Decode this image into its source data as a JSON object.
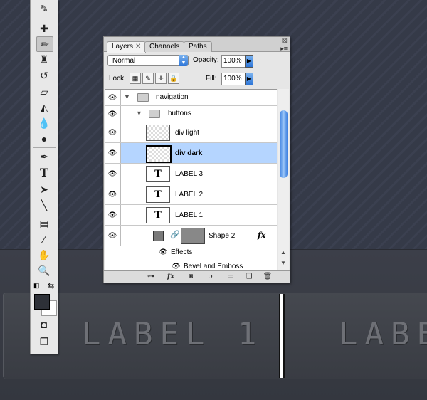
{
  "canvas": {
    "buttons": [
      "LABEL 1",
      "LABE"
    ]
  },
  "tools": {
    "items": [
      "pen-tool",
      "brush",
      "pencil",
      "stamp",
      "history-brush",
      "eraser",
      "paint-bucket",
      "blur",
      "dodge",
      "pen",
      "type",
      "direct-select",
      "line",
      "notes",
      "eyedropper",
      "hand",
      "zoom"
    ]
  },
  "panel": {
    "tabs": [
      "Layers",
      "Channels",
      "Paths"
    ],
    "close_glyph": "✕",
    "blend_mode": "Normal",
    "opacity_label": "Opacity:",
    "opacity_value": "100%",
    "lock_label": "Lock:",
    "fill_label": "Fill:",
    "fill_value": "100%",
    "layers": [
      {
        "name": "navigation"
      },
      {
        "name": "buttons"
      },
      {
        "name": "div light"
      },
      {
        "name": "div dark"
      },
      {
        "name": "LABEL 3"
      },
      {
        "name": "LABEL 2"
      },
      {
        "name": "LABEL 1"
      },
      {
        "name": "Shape 2"
      },
      {
        "name": "Effects"
      },
      {
        "name": "Bevel and Emboss"
      }
    ],
    "text_thumb_glyph": "T",
    "fx_glyph": "fx"
  },
  "colors": {
    "selection": "#b5d5ff",
    "accent": "#2e76d8"
  }
}
